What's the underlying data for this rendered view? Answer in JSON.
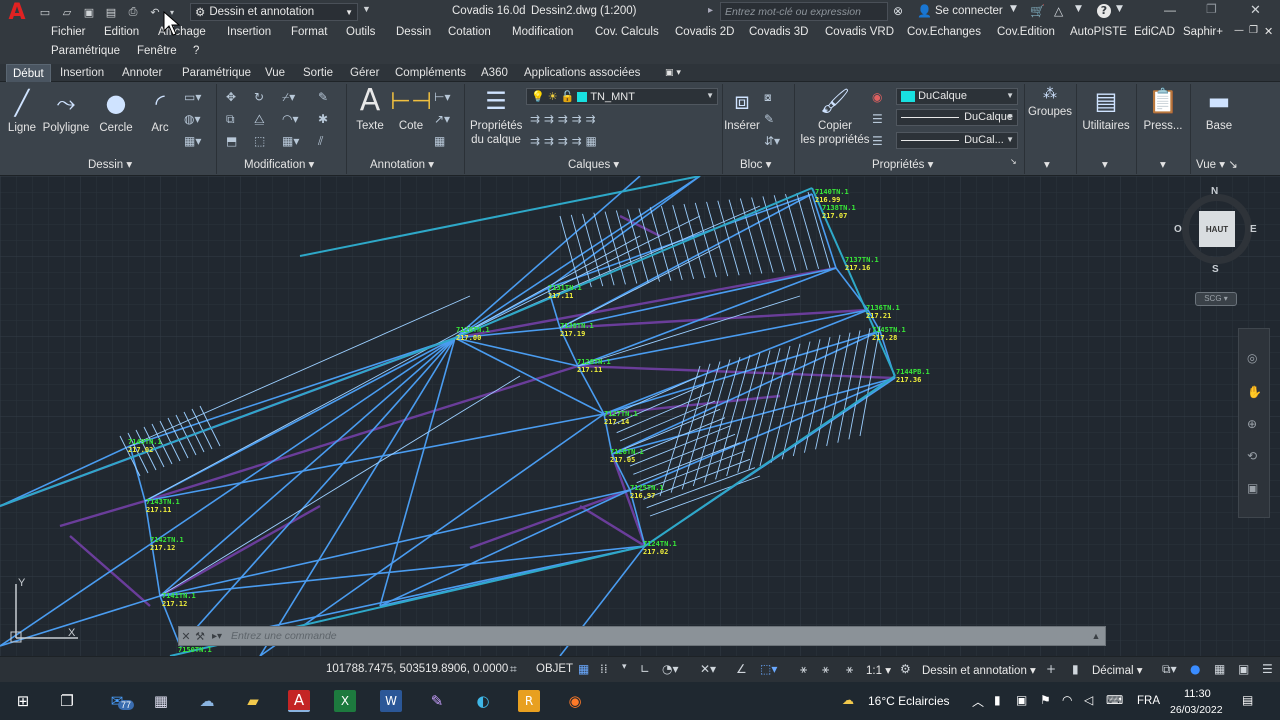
{
  "titlebar": {
    "logo_letter": "A",
    "workspace": "Dessin et annotation",
    "app_title": "Covadis 16.0d",
    "doc_title": "Dessin2.dwg (1:200)",
    "search_placeholder": "Entrez mot-clé ou expression",
    "signin": "Se connecter",
    "help": "?"
  },
  "menubar": {
    "items": [
      "Fichier",
      "Edition",
      "Affichage",
      "Insertion",
      "Format",
      "Outils",
      "Dessin",
      "Cotation",
      "Modification",
      "Cov. Calculs",
      "Covadis 2D",
      "Covadis 3D",
      "Covadis VRD",
      "Cov.Echanges",
      "Cov.Edition",
      "AutoPISTE",
      "EdiCAD",
      "Saphir+"
    ],
    "row2": [
      "Paramétrique",
      "Fenêtre",
      "?"
    ]
  },
  "ribbon_tabs": {
    "active": "Début",
    "items": [
      "Insertion",
      "Annoter",
      "Paramétrique",
      "Vue",
      "Sortie",
      "Gérer",
      "Compléments",
      "A360",
      "Applications associées"
    ]
  },
  "ribbon": {
    "dessin": {
      "title": "Dessin",
      "ligne": "Ligne",
      "polyligne": "Polyligne",
      "cercle": "Cercle",
      "arc": "Arc"
    },
    "modification": {
      "title": "Modification"
    },
    "annotation": {
      "title": "Annotation",
      "texte": "Texte",
      "cote": "Cote"
    },
    "calques": {
      "title": "Calques",
      "proprietes_1": "Propriétés",
      "proprietes_2": "du calque",
      "layer": "TN_MNT"
    },
    "bloc": {
      "title": "Bloc",
      "inserer": "Insérer"
    },
    "proprietes": {
      "title": "Propriétés",
      "copier_1": "Copier",
      "copier_2": "les propriétés",
      "color": "DuCalque",
      "linetype": "DuCalque",
      "lineweight": "DuCal..."
    },
    "groupes": "Groupes",
    "utilitaires": "Utilitaires",
    "presse": "Press...",
    "base": "Base",
    "vue": "Vue"
  },
  "viewcube": {
    "n": "N",
    "s": "S",
    "e": "E",
    "o": "O",
    "face": "HAUT",
    "scg": "SCG"
  },
  "points": [
    {
      "code": "7140TN.1",
      "alt": "216.99"
    },
    {
      "code": "7138TN.1",
      "alt": "217.07"
    },
    {
      "code": "7137TN.1",
      "alt": "217.16"
    },
    {
      "code": "7136TN.1",
      "alt": "217.21"
    },
    {
      "code": "7145TN.1",
      "alt": "217.28"
    },
    {
      "code": "7144PB.1",
      "alt": "217.36"
    },
    {
      "code": "7131TN.1",
      "alt": "217.11"
    },
    {
      "code": "7130TN.1",
      "alt": "217.19"
    },
    {
      "code": "7128TN.1",
      "alt": "217.11"
    },
    {
      "code": "7127TN.1",
      "alt": "217.14"
    },
    {
      "code": "7126TN.1",
      "alt": "217.05"
    },
    {
      "code": "7125TN.1",
      "alt": "216.97"
    },
    {
      "code": "7124TN.1",
      "alt": "217.02"
    },
    {
      "code": "7120TN.1",
      "alt": "217.00"
    },
    {
      "code": "7149TN.1",
      "alt": "217.02"
    },
    {
      "code": "7143TN.1",
      "alt": "217.11"
    },
    {
      "code": "7142TN.1",
      "alt": "217.12"
    },
    {
      "code": "7141TN.1",
      "alt": "217.12"
    },
    {
      "code": "7150TN.1",
      "alt": ""
    }
  ],
  "command_line": {
    "placeholder": "Entrez une commande"
  },
  "statusbar": {
    "coords": "101788.7475, 503519.8906, 0.0000",
    "objet": "OBJET",
    "scale": "1:1",
    "workspace": "Dessin et annotation",
    "units": "Décimal"
  },
  "taskbar": {
    "mail_badge": "77",
    "weather": "16°C  Eclaircies",
    "lang": "FRA",
    "time": "11:30",
    "date": "26/03/2022"
  },
  "colors": {
    "tin_line": "#4a9cf0",
    "tin_light": "#9ccfff",
    "breakline": "#6a3d9a",
    "point_code": "#38e838",
    "point_alt": "#f0f03c"
  }
}
